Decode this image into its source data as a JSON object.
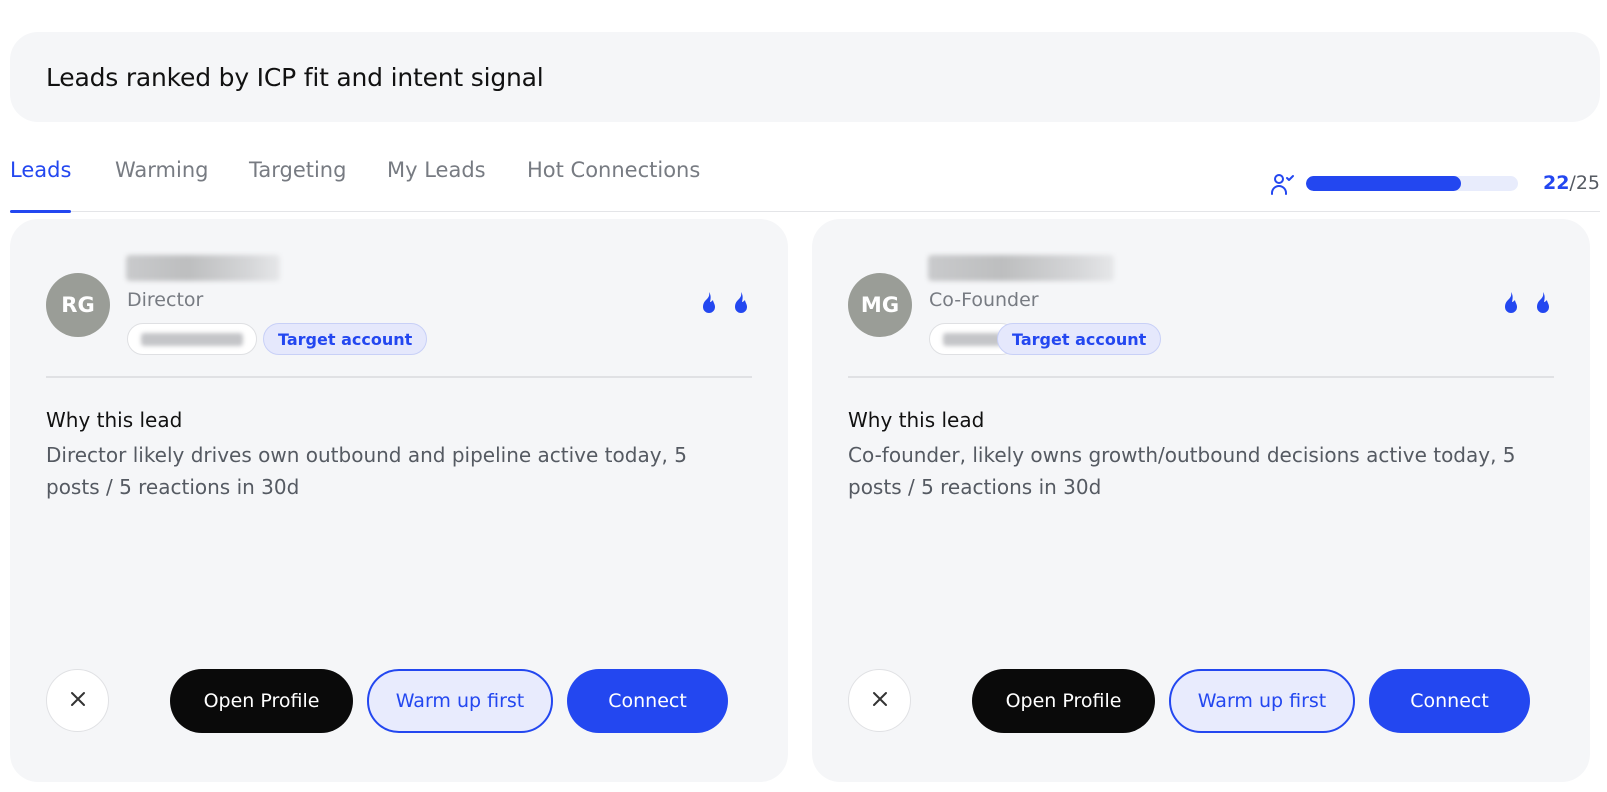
{
  "header": {
    "title": "Leads ranked by ICP fit and intent signal"
  },
  "tabs": [
    {
      "label": "Leads",
      "active": true
    },
    {
      "label": "Warming",
      "active": false
    },
    {
      "label": "Targeting",
      "active": false
    },
    {
      "label": "My Leads",
      "active": false
    },
    {
      "label": "Hot Connections",
      "active": false
    }
  ],
  "progress": {
    "current": "22",
    "total": "/25",
    "fraction": 0.73,
    "icon": "user-check-icon"
  },
  "colors": {
    "accent": "#2347f0",
    "card_bg": "#f5f6f8",
    "avatar_bg": "#9a9d97"
  },
  "leads": [
    {
      "initials": "RG",
      "role": "Director",
      "badge": "Target account",
      "intent_flames": 2,
      "why_title": "Why this lead",
      "why_text": "Director likely drives own outbound and pipeline active today, 5 posts / 5 reactions in 30d",
      "actions": {
        "open": "Open Profile",
        "warm": "Warm up first",
        "connect": "Connect"
      }
    },
    {
      "initials": "MG",
      "role": "Co-Founder",
      "badge": "Target account",
      "intent_flames": 2,
      "why_title": "Why this lead",
      "why_text": "Co-founder, likely owns growth/outbound decisions active today, 5 posts / 5 reactions in 30d",
      "actions": {
        "open": "Open Profile",
        "warm": "Warm up first",
        "connect": "Connect"
      }
    }
  ]
}
